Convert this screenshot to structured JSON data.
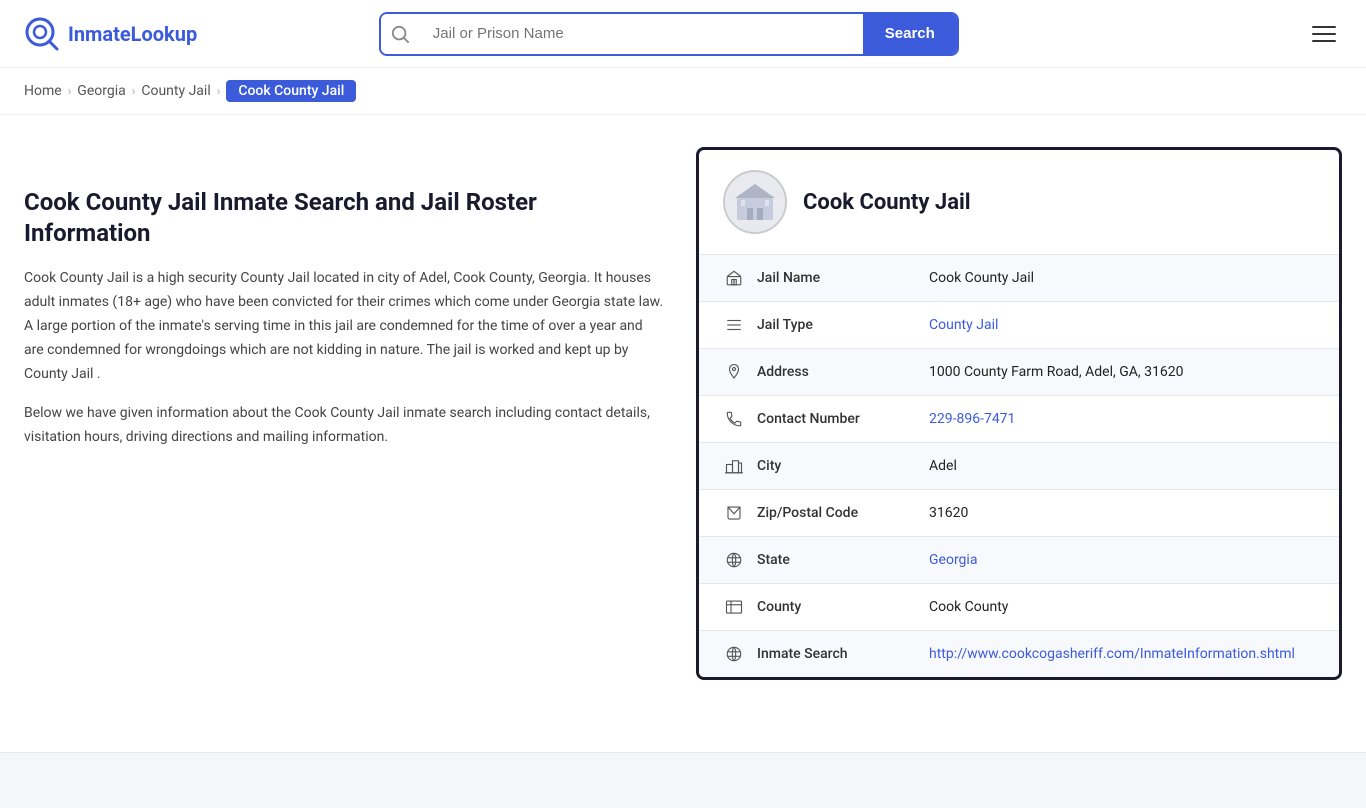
{
  "site": {
    "name_part1": "Inmate",
    "name_part2": "Lookup"
  },
  "header": {
    "search_placeholder": "Jail or Prison Name",
    "search_button_label": "Search"
  },
  "breadcrumb": {
    "items": [
      {
        "label": "Home",
        "href": "#"
      },
      {
        "label": "Georgia",
        "href": "#"
      },
      {
        "label": "County Jail",
        "href": "#"
      }
    ],
    "current": "Cook County Jail"
  },
  "left": {
    "heading": "Cook County Jail Inmate Search and Jail Roster Information",
    "para1": "Cook County Jail is a high security County Jail located in city of Adel, Cook County, Georgia. It houses adult inmates (18+ age) who have been convicted for their crimes which come under Georgia state law. A large portion of the inmate's serving time in this jail are condemned for the time of over a year and are condemned for wrongdoings which are not kidding in nature. The jail is worked and kept up by County Jail .",
    "para2": "Below we have given information about the Cook County Jail inmate search including contact details, visitation hours, driving directions and mailing information."
  },
  "card": {
    "title": "Cook County Jail",
    "fields": [
      {
        "icon": "jail-icon",
        "label": "Jail Name",
        "value": "Cook County Jail",
        "link": null
      },
      {
        "icon": "type-icon",
        "label": "Jail Type",
        "value": "County Jail",
        "link": "#"
      },
      {
        "icon": "address-icon",
        "label": "Address",
        "value": "1000 County Farm Road, Adel, GA, 31620",
        "link": null
      },
      {
        "icon": "phone-icon",
        "label": "Contact Number",
        "value": "229-896-7471",
        "link": "tel:229-896-7471"
      },
      {
        "icon": "city-icon",
        "label": "City",
        "value": "Adel",
        "link": null
      },
      {
        "icon": "zip-icon",
        "label": "Zip/Postal Code",
        "value": "31620",
        "link": null
      },
      {
        "icon": "state-icon",
        "label": "State",
        "value": "Georgia",
        "link": "#"
      },
      {
        "icon": "county-icon",
        "label": "County",
        "value": "Cook County",
        "link": null
      },
      {
        "icon": "web-icon",
        "label": "Inmate Search",
        "value": "http://www.cookcogasheriff.com/InmateInformation.shtml",
        "link": "http://www.cookcogasheriff.com/InmateInformation.shtml"
      }
    ]
  },
  "icons": {
    "jail-icon": "🏛",
    "type-icon": "☰",
    "address-icon": "📍",
    "phone-icon": "📞",
    "city-icon": "🏙",
    "zip-icon": "✉",
    "state-icon": "🌐",
    "county-icon": "🖼",
    "web-icon": "🌐"
  }
}
